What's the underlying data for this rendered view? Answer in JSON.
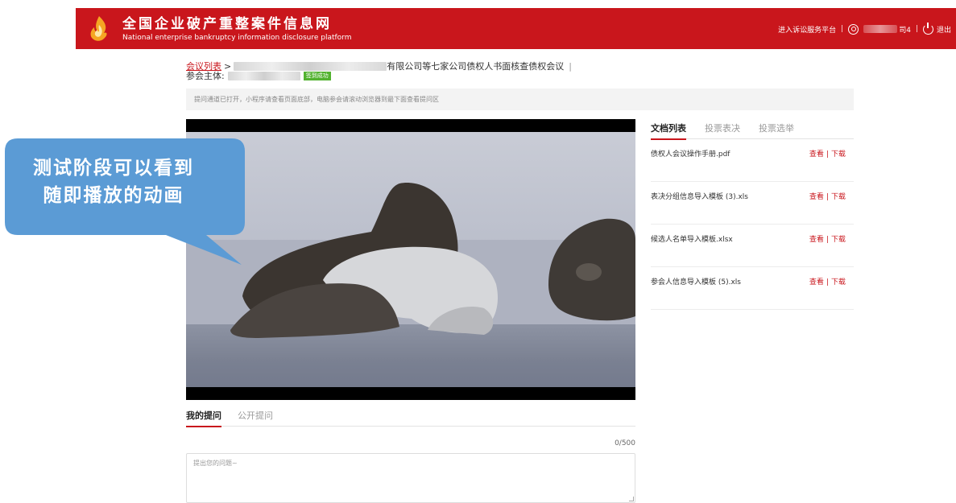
{
  "header": {
    "title": "全国企业破产重整案件信息网",
    "subtitle": "National enterprise bankruptcy information disclosure platform",
    "litigation_link": "进入诉讼服务平台",
    "separator": "|",
    "user_name_suffix": "司4",
    "logout": "退出",
    "brand_color": "#c9161c"
  },
  "breadcrumb": {
    "list_link": "会议列表",
    "arrow": ">",
    "meeting_title": "有限公司等七家公司债权人书面核查债权会议",
    "trail_separator": "|"
  },
  "participant": {
    "label": "参会主体:",
    "badge": "签到成功"
  },
  "notice": "提问通道已打开，小程序请查看页面底部，电脑参会请滚动浏览器到最下面查看提问区",
  "callout": {
    "line1": "测试阶段可以看到",
    "line2": "随即播放的动画",
    "color": "#5b9bd5"
  },
  "doc_tabs": [
    {
      "label": "文档列表",
      "active": true
    },
    {
      "label": "投票表决",
      "active": false
    },
    {
      "label": "投票选举",
      "active": false
    }
  ],
  "documents": [
    {
      "name": "债权人会议操作手册.pdf",
      "view": "查看",
      "download": "下载"
    },
    {
      "name": "表决分组信息导入模板 (3).xls",
      "view": "查看",
      "download": "下载"
    },
    {
      "name": "候选人名单导入模板.xlsx",
      "view": "查看",
      "download": "下载"
    },
    {
      "name": "参会人信息导入模板 (5).xls",
      "view": "查看",
      "download": "下载"
    }
  ],
  "question_tabs": [
    {
      "label": "我的提问",
      "active": true
    },
    {
      "label": "公开提问",
      "active": false
    }
  ],
  "question": {
    "counter": "0/500",
    "placeholder": "提出您的问题~",
    "value": ""
  }
}
